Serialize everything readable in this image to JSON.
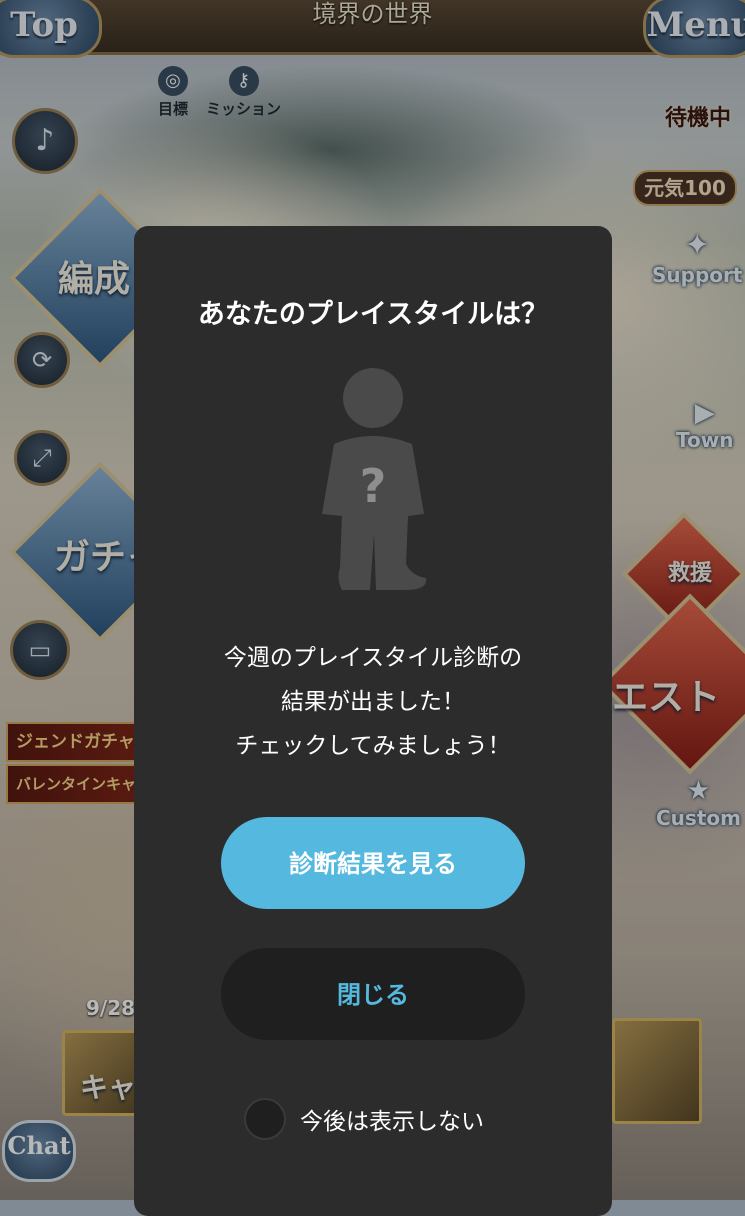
{
  "header": {
    "top_label": "Top",
    "area_name": "境界の世界",
    "menu_label": "Menu"
  },
  "shortcuts": {
    "goal_label": "目標",
    "mission_label": "ミッション"
  },
  "status": {
    "waiting_label": "待機中",
    "genki_label": "元気100"
  },
  "main_menu": {
    "party_label": "編成",
    "gacha_label": "ガチャ",
    "quest_label": "エスト",
    "rescue_label": "救援"
  },
  "side_links": {
    "support_label": "Support",
    "town_label": "Town",
    "custom_label": "Custom"
  },
  "banners": {
    "legend_gacha": "ジェンドガチャ",
    "valentine": "バレンタインキャラ"
  },
  "event": {
    "date": "9/28",
    "card_label": "キャ"
  },
  "chat": {
    "label": "Chat"
  },
  "dialog": {
    "title": "あなたのプレイスタイルは？",
    "avatar_mark": "?",
    "message_lines": [
      "今週のプレイスタイル診断の",
      "結果が出ました！",
      "チェックしてみましょう！"
    ],
    "primary_button": "診断結果を見る",
    "close_button": "閉じる",
    "dont_show_label": "今後は表示しない",
    "dont_show_checked": false
  },
  "colors": {
    "dialog_bg": "#2c2c2c",
    "primary_accent": "#55b8df",
    "secondary_button_bg": "#1f1f1f"
  },
  "icons": {
    "music": "music-note-icon",
    "refresh": "refresh-icon",
    "expand": "expand-icon",
    "ticket": "ticket-icon",
    "goal": "target-icon",
    "mission": "key-icon",
    "support": "support-icon",
    "town": "play-arrow-icon",
    "custom": "star-icon"
  }
}
